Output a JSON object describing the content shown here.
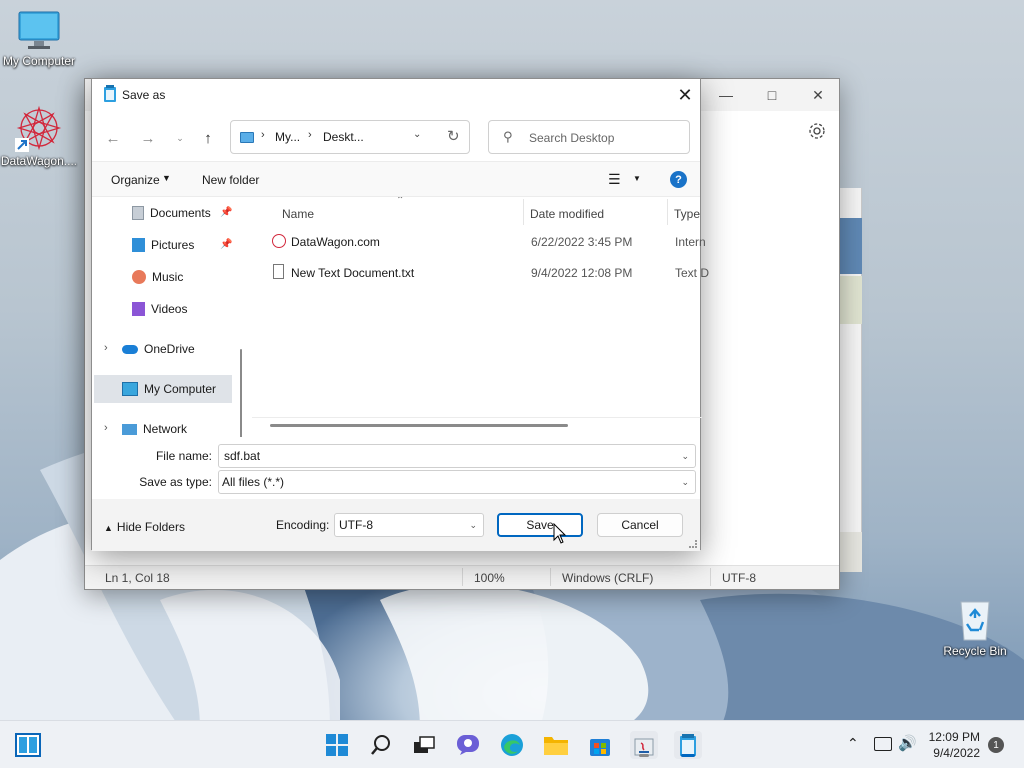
{
  "desktop": {
    "icons": [
      {
        "label": "My Computer",
        "icon": "monitor-icon"
      },
      {
        "label": "DataWagon....",
        "icon": "datawagon-icon"
      },
      {
        "label": "Recycle Bin",
        "icon": "recycle-bin-icon"
      }
    ]
  },
  "notepad": {
    "status": {
      "position": "Ln 1, Col 18",
      "zoom": "100%",
      "line_endings": "Windows (CRLF)",
      "encoding": "UTF-8"
    }
  },
  "dialog": {
    "title": "Save as",
    "breadcrumb": [
      "My...",
      "Deskt..."
    ],
    "search_placeholder": "Search Desktop",
    "commands": {
      "organize": "Organize",
      "new_folder": "New folder"
    },
    "nav_items": [
      {
        "label": "Documents",
        "icon": "documents-icon"
      },
      {
        "label": "Pictures",
        "icon": "pictures-icon"
      },
      {
        "label": "Music",
        "icon": "music-icon"
      },
      {
        "label": "Videos",
        "icon": "videos-icon"
      },
      {
        "label": "OneDrive",
        "icon": "onedrive-icon"
      },
      {
        "label": "My Computer",
        "icon": "monitor-icon"
      },
      {
        "label": "Network",
        "icon": "network-icon"
      }
    ],
    "columns": {
      "name": "Name",
      "date": "Date modified",
      "type": "Type"
    },
    "files": [
      {
        "name": "DataWagon.com",
        "date": "6/22/2022 3:45 PM",
        "type": "Intern"
      },
      {
        "name": "New Text Document.txt",
        "date": "9/4/2022 12:08 PM",
        "type": "Text D"
      }
    ],
    "file_name_label": "File name:",
    "file_name_value": "sdf.bat",
    "save_type_label": "Save as type:",
    "save_type_value": "All files  (*.*)",
    "hide_folders": "Hide Folders",
    "encoding_label": "Encoding:",
    "encoding_value": "UTF-8",
    "save": "Save",
    "cancel": "Cancel"
  },
  "taskbar": {
    "time": "12:09 PM",
    "date": "9/4/2022",
    "notifications": "1"
  },
  "colors": {
    "accent": "#0067c0",
    "help": "#1a73c8"
  }
}
